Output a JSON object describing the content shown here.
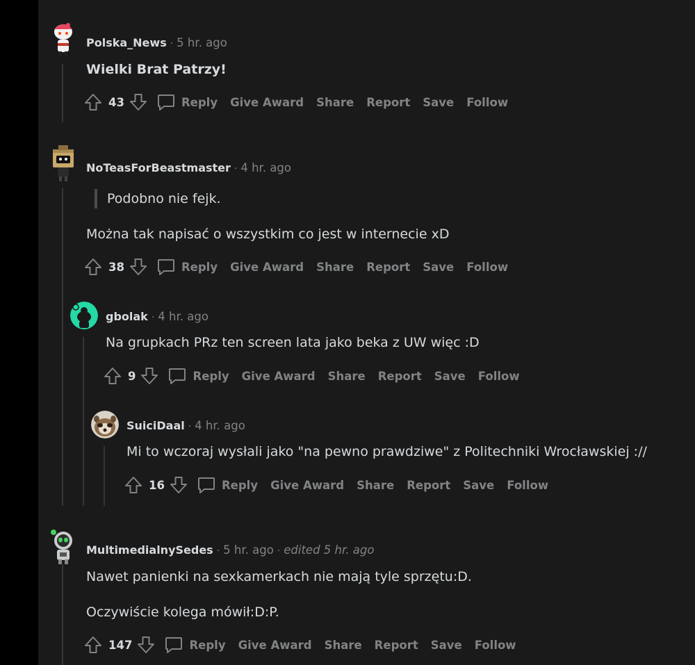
{
  "comments": [
    {
      "author": "Polska_News",
      "time": "5 hr. ago",
      "body": "Wielki Brat Patrzy!",
      "score": "43",
      "actions": {
        "reply": "Reply",
        "award": "Give Award",
        "share": "Share",
        "report": "Report",
        "save": "Save",
        "follow": "Follow"
      }
    },
    {
      "author": "NoTeasForBeastmaster",
      "time": "4 hr. ago",
      "quote": "Podobno nie fejk.",
      "body": "Można tak napisać o wszystkim co jest w internecie xD",
      "score": "38",
      "actions": {
        "reply": "Reply",
        "award": "Give Award",
        "share": "Share",
        "report": "Report",
        "save": "Save",
        "follow": "Follow"
      }
    },
    {
      "author": "gbolak",
      "time": "4 hr. ago",
      "body": "Na grupkach PRz ten screen lata jako beka z UW więc :D",
      "score": "9",
      "actions": {
        "reply": "Reply",
        "award": "Give Award",
        "share": "Share",
        "report": "Report",
        "save": "Save",
        "follow": "Follow"
      }
    },
    {
      "author": "SuiciDaal",
      "time": "4 hr. ago",
      "body": "Mi to wczoraj wysłali jako \"na pewno prawdziwe\" z Politechniki Wrocławskiej ://",
      "score": "16",
      "actions": {
        "reply": "Reply",
        "award": "Give Award",
        "share": "Share",
        "report": "Report",
        "save": "Save",
        "follow": "Follow"
      }
    },
    {
      "author": "MultimedialnySedes",
      "time": "5 hr. ago",
      "edited": "edited 5 hr. ago",
      "body": "Nawet panienki na sexkamerkach nie mają tyle sprzętu:D.",
      "body2": "Oczywiście kolega mówił:D:P.",
      "score": "147",
      "actions": {
        "reply": "Reply",
        "award": "Give Award",
        "share": "Share",
        "report": "Report",
        "save": "Save",
        "follow": "Follow"
      }
    }
  ],
  "colors": {
    "background": "#1a1a1b",
    "text": "#d7dadc",
    "muted": "#818384",
    "thread_line": "#343536"
  },
  "icons": [
    "upvote-icon",
    "downvote-icon",
    "comment-bubble-icon",
    "avatar"
  ]
}
